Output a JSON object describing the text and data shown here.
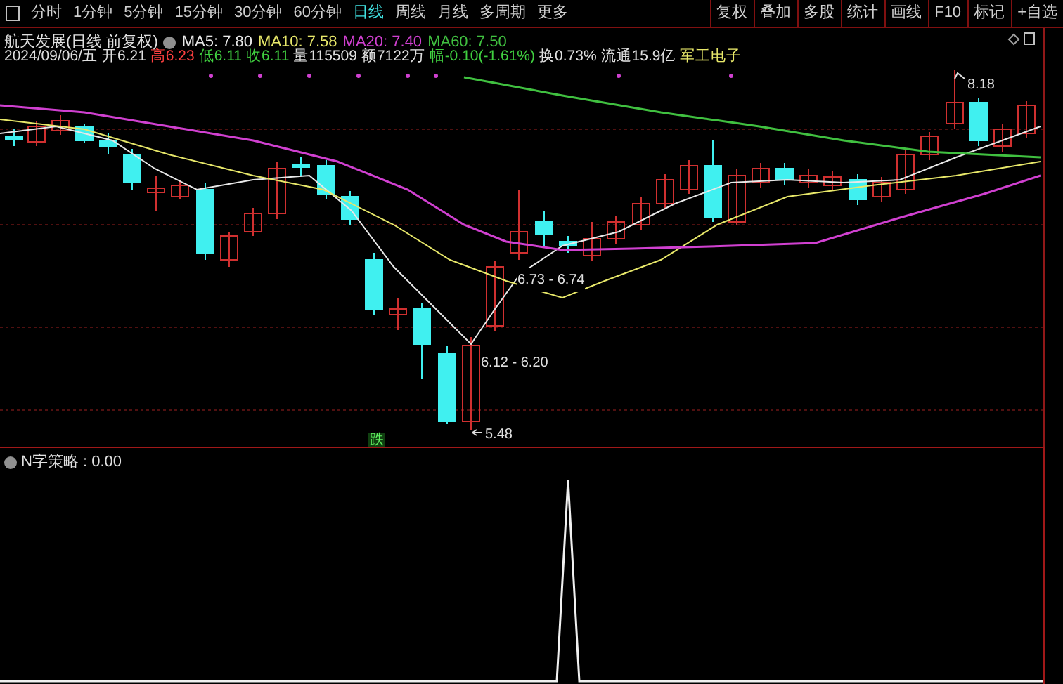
{
  "toolbar": {
    "periods": [
      {
        "label": "分时",
        "selected": false
      },
      {
        "label": "1分钟",
        "selected": false
      },
      {
        "label": "5分钟",
        "selected": false
      },
      {
        "label": "15分钟",
        "selected": false
      },
      {
        "label": "30分钟",
        "selected": false
      },
      {
        "label": "60分钟",
        "selected": false
      },
      {
        "label": "日线",
        "selected": true
      },
      {
        "label": "周线",
        "selected": false
      },
      {
        "label": "月线",
        "selected": false
      },
      {
        "label": "多周期",
        "selected": false
      },
      {
        "label": "更多",
        "selected": false
      }
    ],
    "buttons": [
      "复权",
      "叠加",
      "多股",
      "统计",
      "画线",
      "F10",
      "标记",
      "+自选"
    ]
  },
  "stock": {
    "title": "航天发展(日线 前复权)",
    "moving_averages": [
      {
        "label": "MA5: 7.80",
        "color": "#e8e8e8"
      },
      {
        "label": "MA10: 7.58",
        "color": "#e8e86a"
      },
      {
        "label": "MA20: 7.40",
        "color": "#d040d0"
      },
      {
        "label": "MA60: 7.50",
        "color": "#40c040"
      }
    ],
    "info": [
      {
        "text": "2024/09/06/五",
        "color": "#e0e0e0"
      },
      {
        "text": "开6.21",
        "color": "#e0e0e0"
      },
      {
        "text": "高6.23",
        "color": "#ff4040"
      },
      {
        "text": "低6.11",
        "color": "#40d040"
      },
      {
        "text": "收6.11",
        "color": "#40d040"
      },
      {
        "text": "量115509",
        "color": "#e0e0e0"
      },
      {
        "text": "额7122万",
        "color": "#e0e0e0"
      },
      {
        "text": "幅-0.10(-1.61%)",
        "color": "#40d040"
      },
      {
        "text": "换0.73%",
        "color": "#e0e0e0"
      },
      {
        "text": "流通15.9亿",
        "color": "#e0e0e0"
      },
      {
        "text": "军工电子",
        "color": "#e8e86a"
      }
    ]
  },
  "chart": {
    "high_label": "8.18",
    "range_labels": [
      "6.73 - 6.74",
      "6.12 - 6.20"
    ],
    "low_label": "5.48",
    "signal": "跌"
  },
  "indicator": {
    "label": "N字策略 : 0.00"
  }
}
